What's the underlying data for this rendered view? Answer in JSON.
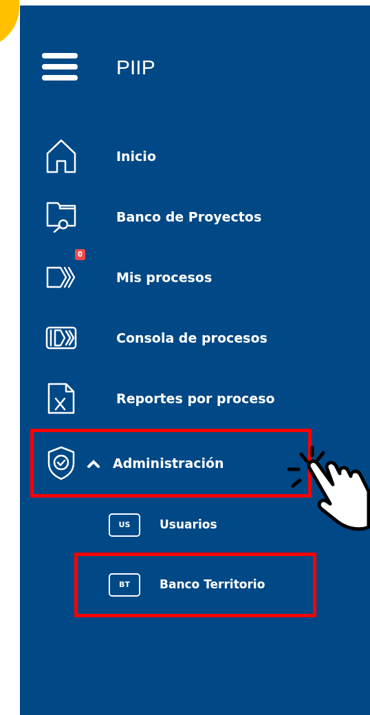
{
  "header": {
    "title": "PIIP"
  },
  "menu": [
    {
      "label": "Inicio",
      "highlighted": false
    },
    {
      "label": "Banco de Proyectos",
      "highlighted": false
    },
    {
      "label": "Mis procesos",
      "badge": "0",
      "highlighted": false
    },
    {
      "label": "Consola de procesos",
      "highlighted": false
    },
    {
      "label": "Reportes por proceso",
      "highlighted": false
    },
    {
      "label": "Administración",
      "expanded": true,
      "highlighted": true,
      "children": [
        {
          "label": "Usuarios",
          "abbr": "US",
          "highlighted": false
        },
        {
          "label": "Banco Territorio",
          "abbr": "BT",
          "highlighted": true
        }
      ]
    }
  ]
}
